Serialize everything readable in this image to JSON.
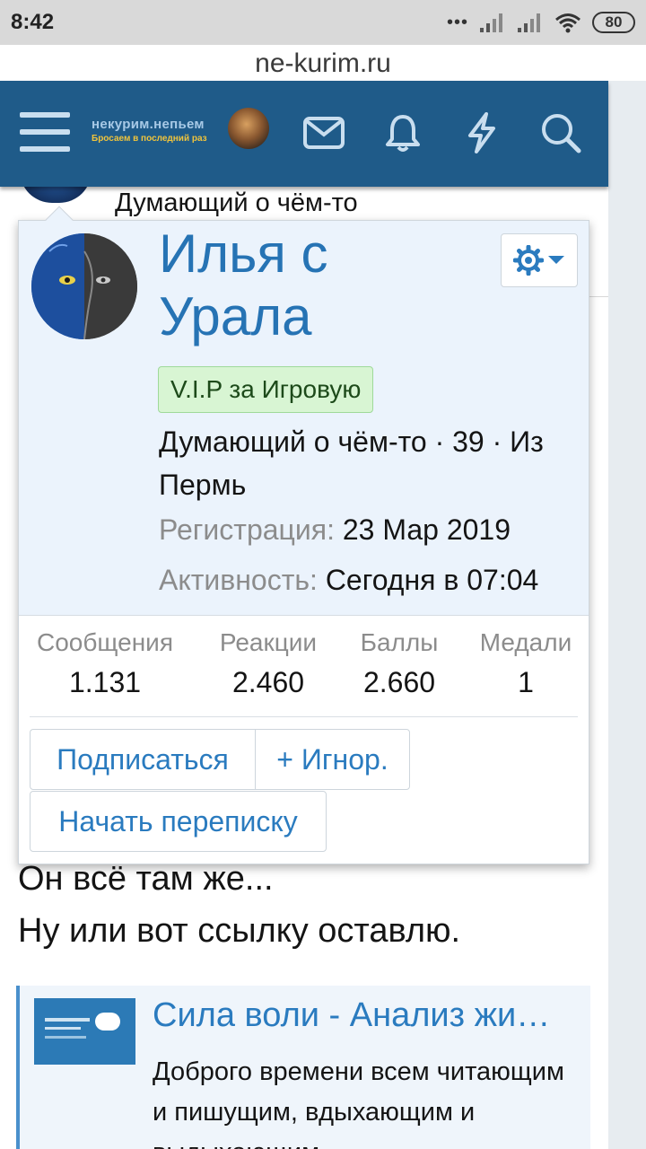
{
  "status_bar": {
    "time": "8:42",
    "battery": "80"
  },
  "browser": {
    "url": "ne-kurim.ru"
  },
  "header": {
    "logo_main": "некурим.непьем",
    "logo_tagline": "Бросаем в последний раз",
    "colors": {
      "background": "#1f5b89",
      "icon": "#c9deef"
    }
  },
  "background": {
    "status_text": "Думающий о чём-то",
    "post_line1": "Он всё там же...",
    "post_line2": "Ну или вот ссылку оставлю.",
    "link_card": {
      "title": "Сила воли - Анализ жи…",
      "description": "Доброго времени всем читающим и пишущим, вдыхающим и выдыхающим"
    }
  },
  "popup": {
    "name": "Илья с Урала",
    "badge": "V.I.P за Игровую",
    "info": "Думающий о чём-то · 39 · Из Пермь",
    "registration_label": "Регистрация:",
    "registration_value": "23 Мар 2019",
    "activity_label": "Активность:",
    "activity_value": "Сегодня в 07:04",
    "stats": [
      {
        "label": "Сообщения",
        "value": "1.131"
      },
      {
        "label": "Реакции",
        "value": "2.460"
      },
      {
        "label": "Баллы",
        "value": "2.660"
      },
      {
        "label": "Медали",
        "value": "1"
      }
    ],
    "buttons": {
      "subscribe": "Подписаться",
      "ignore": "+ Игнор.",
      "start_conversation": "Начать переписку"
    }
  }
}
